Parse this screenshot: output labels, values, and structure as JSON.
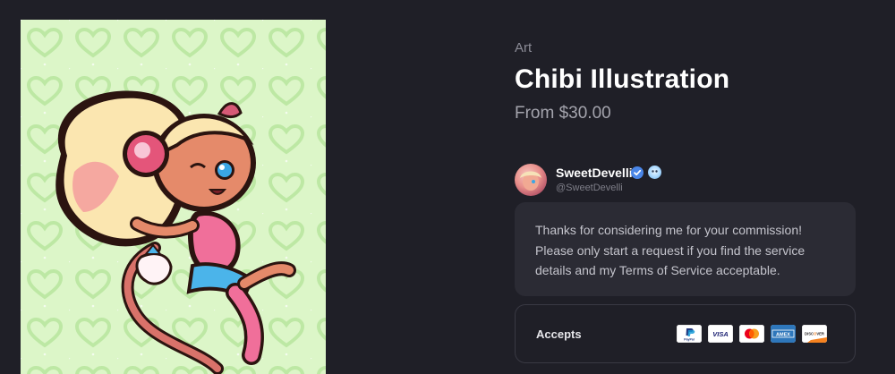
{
  "product": {
    "category": "Art",
    "title": "Chibi Illustration",
    "price": "From $30.00"
  },
  "seller": {
    "name": "SweetDevelli",
    "handle": "@SweetDevelli",
    "icons": [
      "verified-badge-icon",
      "profile-badge-icon"
    ]
  },
  "message": {
    "text": "Thanks for considering me for your commission! Please only start a request if you find the service details and my Terms of Service acceptable."
  },
  "payments": {
    "label": "Accepts",
    "methods": [
      "PayPal",
      "VISA",
      "Mastercard",
      "AMEX",
      "DISCOVER"
    ]
  },
  "colors": {
    "background": "#1f1f27",
    "card": "#2b2b34",
    "artwork_background": "#dcf6c8",
    "verified": "#4a86e8"
  }
}
